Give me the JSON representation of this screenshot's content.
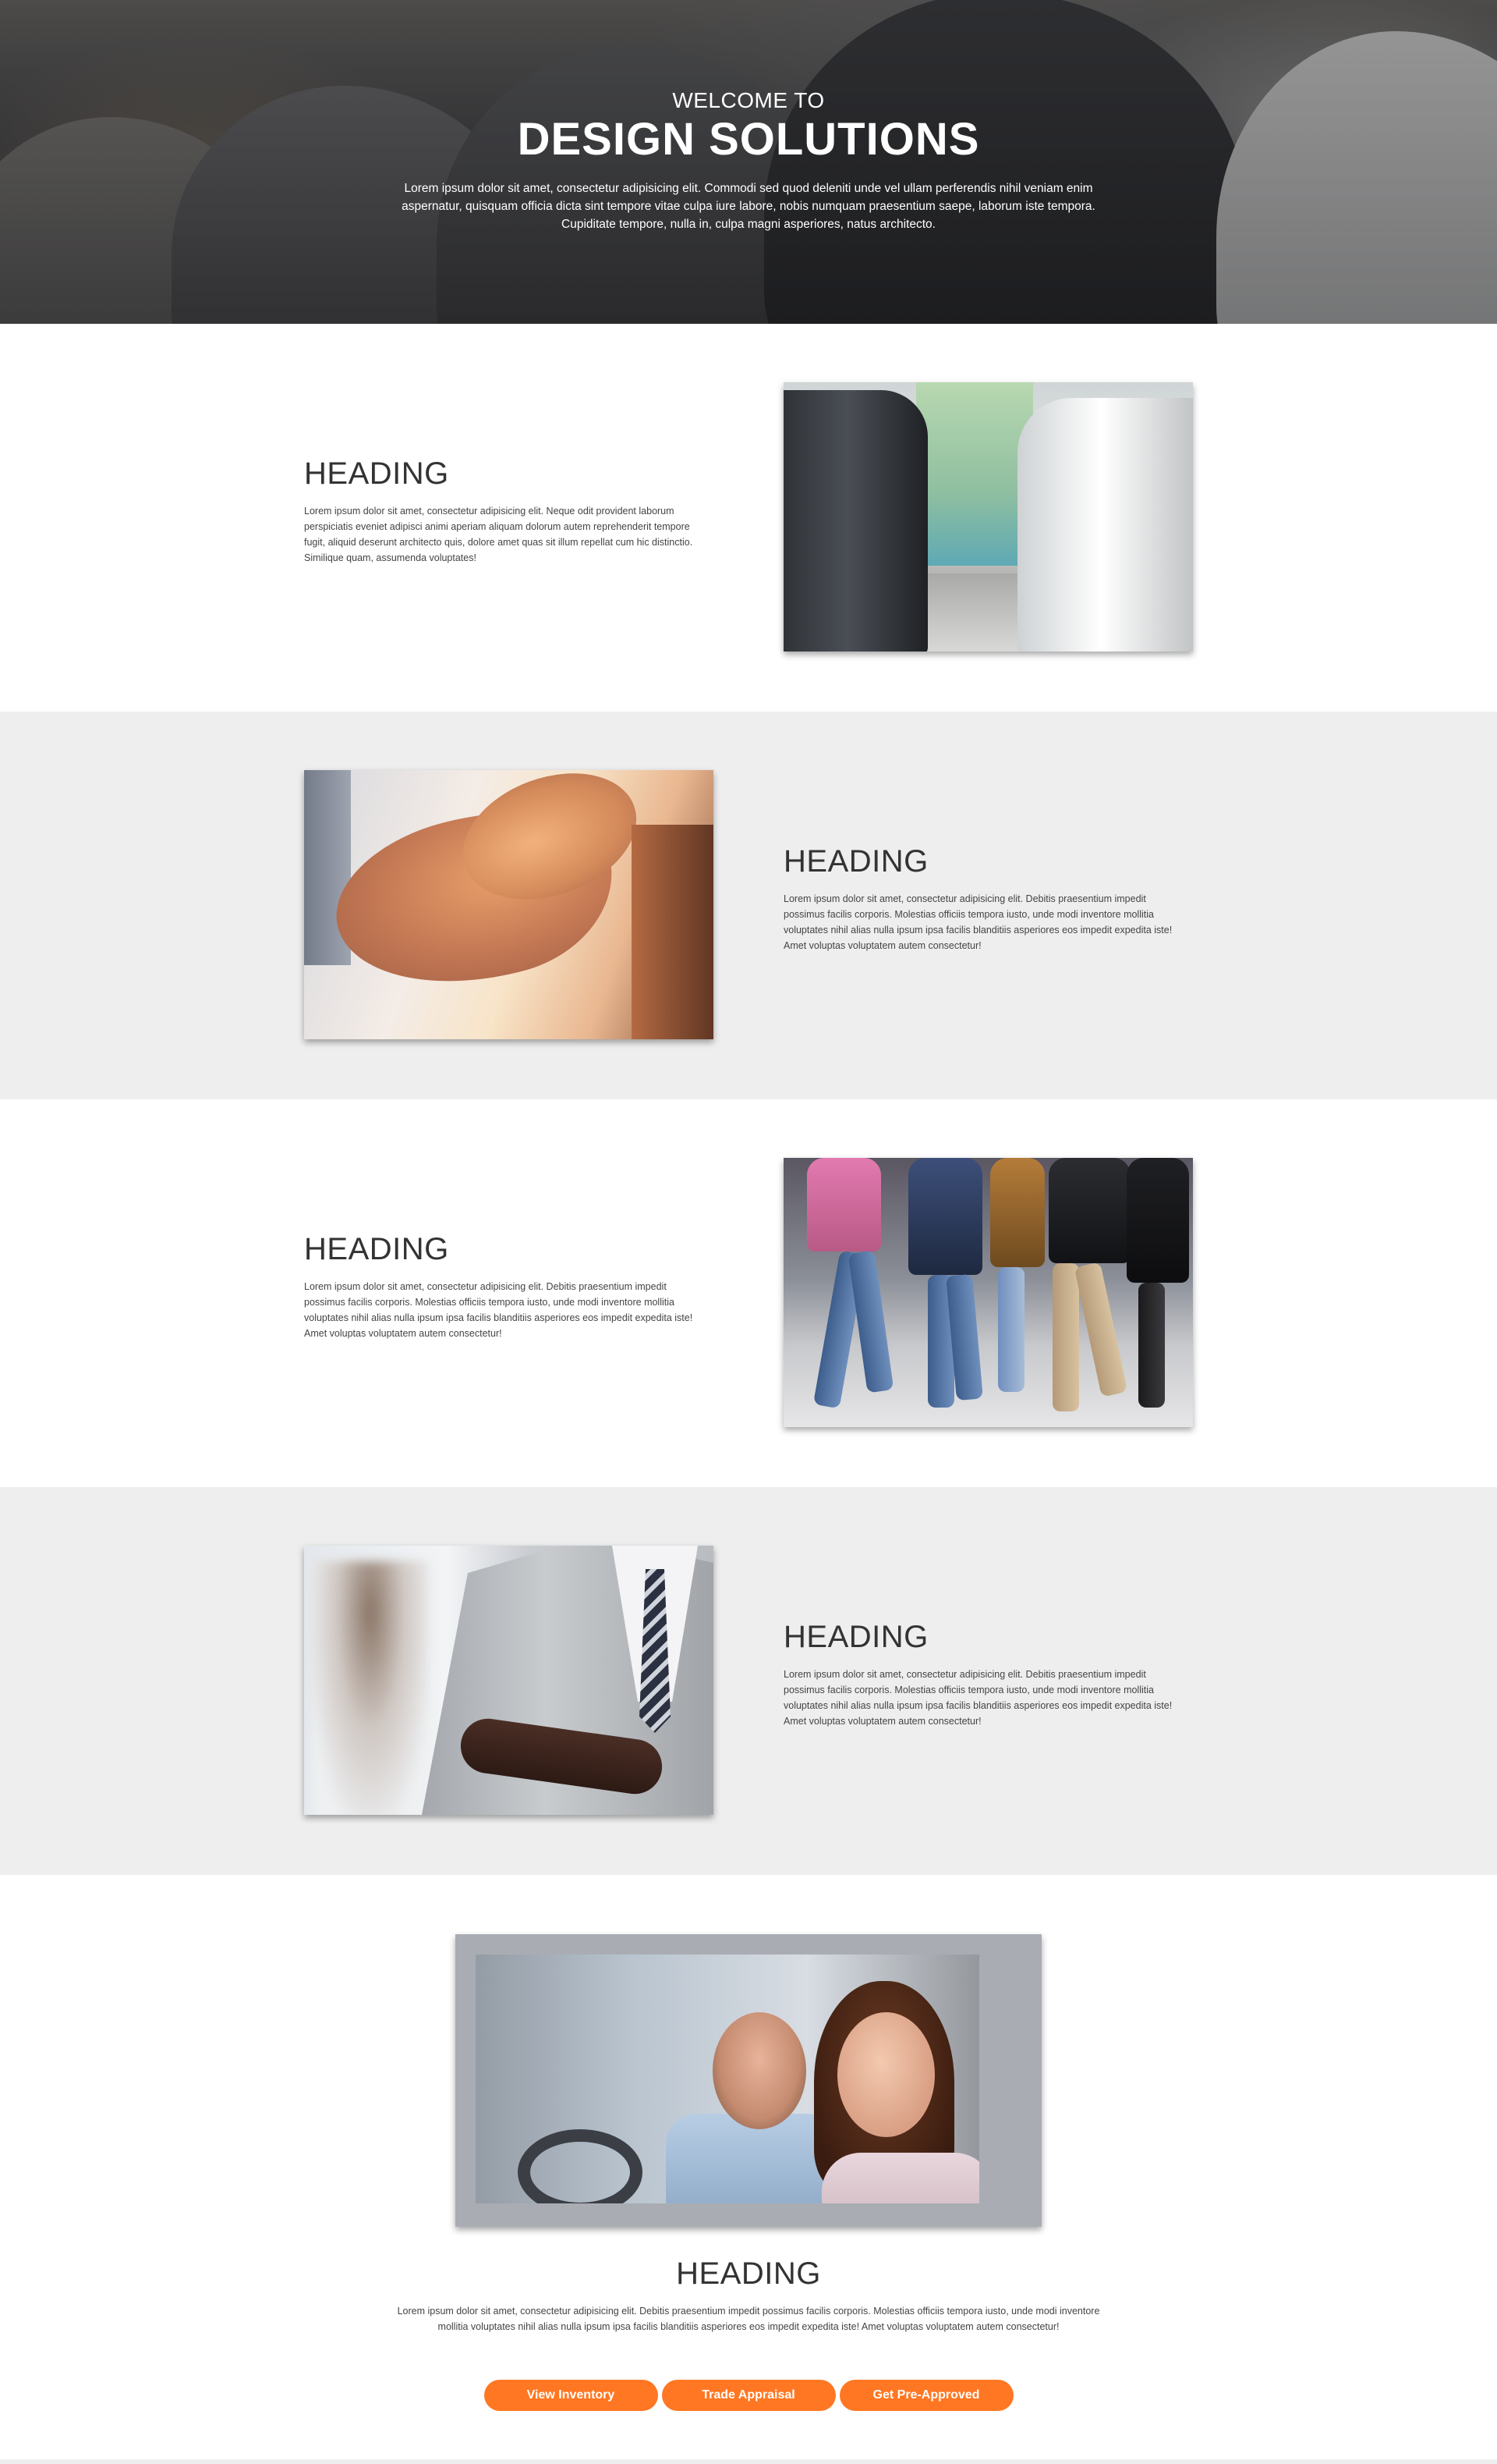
{
  "hero": {
    "welcome": "WELCOME TO",
    "title": "DESIGN SOLUTIONS",
    "text": "Lorem ipsum dolor sit amet, consectetur adipisicing elit. Commodi sed quod deleniti unde vel ullam perferendis nihil veniam enim aspernatur, quisquam officia dicta sint tempore vitae culpa iure labore, nobis numquam praesentium saepe, laborum iste tempora. Cupiditate tempore, nulla in, culpa magni asperiores, natus architecto."
  },
  "sections": [
    {
      "heading": "HEADING",
      "text": "Lorem ipsum dolor sit amet, consectetur adipisicing elit. Neque odit provident laborum perspiciatis eveniet adipisci animi aperiam aliquam dolorum autem reprehenderit tempore fugit, aliquid deserunt architecto quis, dolore amet quas sit illum repellat cum hic distinctio. Similique quam, assumenda voluptates!"
    },
    {
      "heading": "HEADING",
      "text": "Lorem ipsum dolor sit amet, consectetur adipisicing elit. Debitis praesentium impedit possimus facilis corporis. Molestias officiis tempora iusto, unde modi inventore mollitia voluptates nihil alias nulla ipsum ipsa facilis blanditiis asperiores eos impedit expedita iste! Amet voluptas voluptatem autem consectetur!"
    },
    {
      "heading": "HEADING",
      "text": "Lorem ipsum dolor sit amet, consectetur adipisicing elit. Debitis praesentium impedit possimus facilis corporis. Molestias officiis tempora iusto, unde modi inventore mollitia voluptates nihil alias nulla ipsum ipsa facilis blanditiis asperiores eos impedit expedita iste! Amet voluptas voluptatem autem consectetur!"
    },
    {
      "heading": "HEADING",
      "text": "Lorem ipsum dolor sit amet, consectetur adipisicing elit. Debitis praesentium impedit possimus facilis corporis. Molestias officiis tempora iusto, unde modi inventore mollitia voluptates nihil alias nulla ipsum ipsa facilis blanditiis asperiores eos impedit expedita iste! Amet voluptas voluptatem autem consectetur!"
    }
  ],
  "final": {
    "heading": "HEADING",
    "text": "Lorem ipsum dolor sit amet, consectetur adipisicing elit. Debitis praesentium impedit possimus facilis corporis. Molestias officiis tempora iusto, unde modi inventore mollitia voluptates nihil alias nulla ipsum ipsa facilis blanditiis asperiores eos impedit expedita iste! Amet voluptas voluptatem autem consectetur!",
    "buttons": {
      "view_inventory": "View Inventory",
      "trade_appraisal": "Trade Appraisal",
      "pre_approved": "Get Pre-Approved"
    }
  },
  "colors": {
    "accent": "#ff7722",
    "gray_band": "#eeeeee",
    "heading": "#333333"
  }
}
